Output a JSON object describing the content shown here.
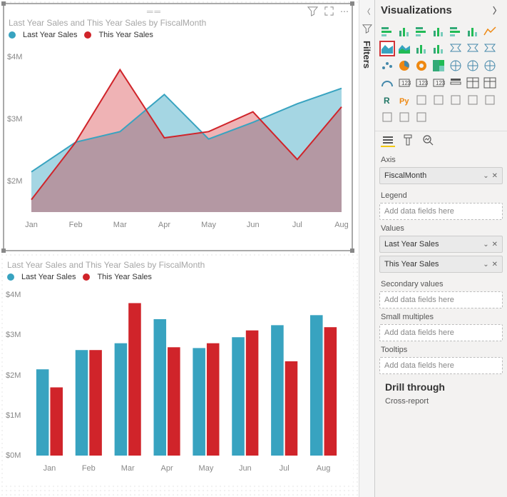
{
  "colors": {
    "lastYear": "#38a3c0",
    "thisYear": "#d0242a",
    "lastYearFill": "rgba(56,163,192,0.45)",
    "thisYearFill": "rgba(208,36,42,0.35)"
  },
  "chart1": {
    "title": "Last Year Sales and This Year Sales by FiscalMonth",
    "legend": {
      "a": "Last Year Sales",
      "b": "This Year Sales"
    }
  },
  "chart2": {
    "title": "Last Year Sales and This Year Sales by FiscalMonth",
    "legend": {
      "a": "Last Year Sales",
      "b": "This Year Sales"
    }
  },
  "chart_data": [
    {
      "type": "area",
      "title": "Last Year Sales and This Year Sales by FiscalMonth",
      "xlabel": "",
      "ylabel": "",
      "categories": [
        "Jan",
        "Feb",
        "Mar",
        "Apr",
        "May",
        "Jun",
        "Jul",
        "Aug"
      ],
      "yticks": [
        "$4M",
        "$3M",
        "$2M"
      ],
      "ylim": [
        0,
        4200000
      ],
      "series": [
        {
          "name": "Last Year Sales",
          "values": [
            2150000,
            2630000,
            2800000,
            3400000,
            2680000,
            2950000,
            3250000,
            3500000
          ]
        },
        {
          "name": "This Year Sales",
          "values": [
            1700000,
            2630000,
            3800000,
            2700000,
            2800000,
            3120000,
            2350000,
            3200000
          ]
        }
      ]
    },
    {
      "type": "bar",
      "title": "Last Year Sales and This Year Sales by FiscalMonth",
      "xlabel": "",
      "ylabel": "",
      "categories": [
        "Jan",
        "Feb",
        "Mar",
        "Apr",
        "May",
        "Jun",
        "Jul",
        "Aug"
      ],
      "yticks": [
        "$4M",
        "$3M",
        "$2M",
        "$1M",
        "$0M"
      ],
      "ylim": [
        0,
        4200000
      ],
      "series": [
        {
          "name": "Last Year Sales",
          "values": [
            2150000,
            2630000,
            2800000,
            3400000,
            2680000,
            2950000,
            3250000,
            3500000
          ]
        },
        {
          "name": "This Year Sales",
          "values": [
            1700000,
            2630000,
            3800000,
            2700000,
            2800000,
            3120000,
            2350000,
            3200000
          ]
        }
      ]
    }
  ],
  "filters": {
    "label": "Filters"
  },
  "panel": {
    "title": "Visualizations",
    "wells": {
      "axis": {
        "label": "Axis",
        "items": [
          "FiscalMonth"
        ]
      },
      "legend": {
        "label": "Legend",
        "placeholder": "Add data fields here"
      },
      "values": {
        "label": "Values",
        "items": [
          "Last Year Sales",
          "This Year Sales"
        ]
      },
      "secondary": {
        "label": "Secondary values",
        "placeholder": "Add data fields here"
      },
      "small": {
        "label": "Small multiples",
        "placeholder": "Add data fields here"
      },
      "tooltips": {
        "label": "Tooltips",
        "placeholder": "Add data fields here"
      }
    },
    "drill": "Drill through",
    "crossreport": "Cross-report",
    "icons": [
      "stacked-bar",
      "stacked-column",
      "clustered-bar",
      "clustered-column",
      "100-stacked-bar",
      "100-stacked-column",
      "line",
      "area",
      "stacked-area",
      "line-stacked-column",
      "line-clustered-column",
      "ribbon",
      "waterfall",
      "funnel",
      "scatter",
      "pie",
      "donut",
      "treemap",
      "map",
      "filled-map",
      "azure-map",
      "gauge",
      "card",
      "multi-row-card",
      "kpi",
      "slicer",
      "table",
      "matrix",
      "r-visual",
      "py-visual",
      "key-influencers",
      "decomposition-tree",
      "qna",
      "paginated",
      "smart-narrative",
      "arcgis",
      "powerapps",
      "get-more"
    ]
  }
}
